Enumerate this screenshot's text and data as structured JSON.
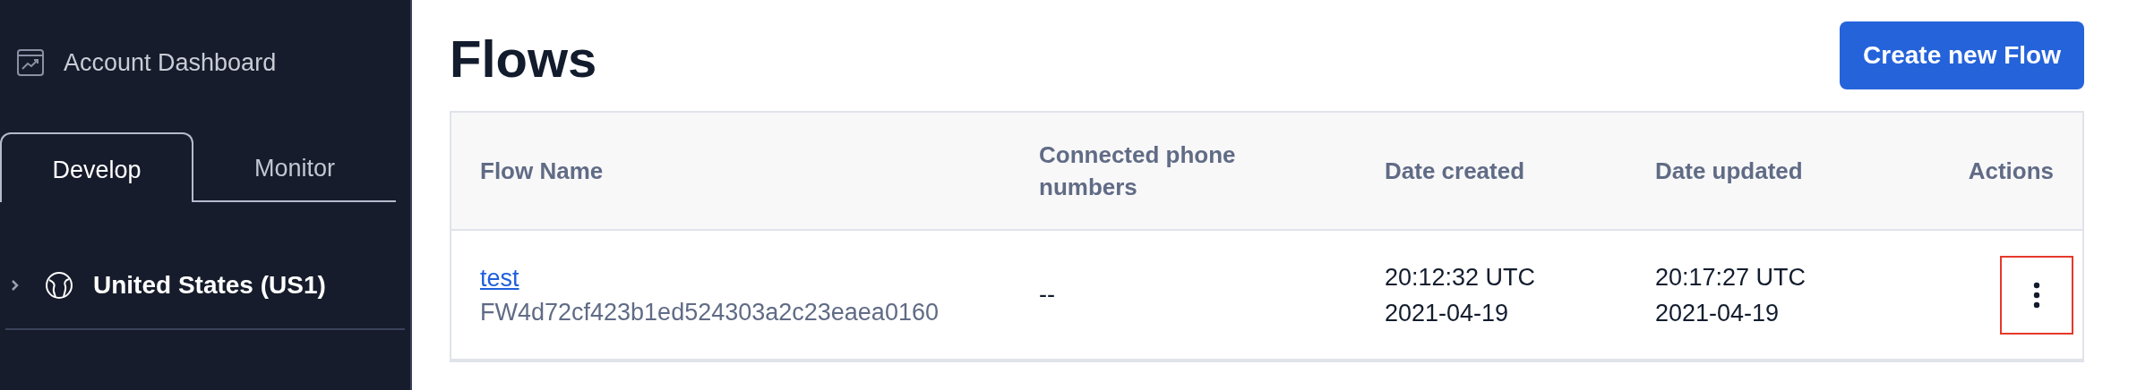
{
  "sidebar": {
    "dashboard_link": "Account Dashboard",
    "tabs": [
      {
        "label": "Develop",
        "selected": true
      },
      {
        "label": "Monitor",
        "selected": false
      }
    ],
    "tree": [
      {
        "label": "United States (US1)",
        "expanded": false
      }
    ]
  },
  "page": {
    "title": "Flows",
    "create_button": "Create new Flow"
  },
  "table": {
    "columns": [
      "Flow Name",
      "Connected phone numbers",
      "Date created",
      "Date updated",
      "Actions"
    ],
    "rows": [
      {
        "name": "test",
        "sid": "FW4d72cf423b1ed524303a2c23eaea0160",
        "phone_numbers": "--",
        "created_time": "20:12:32 UTC",
        "created_date": "2021-04-19",
        "updated_time": "20:17:27 UTC",
        "updated_date": "2021-04-19",
        "actions_highlighted": true
      }
    ]
  }
}
